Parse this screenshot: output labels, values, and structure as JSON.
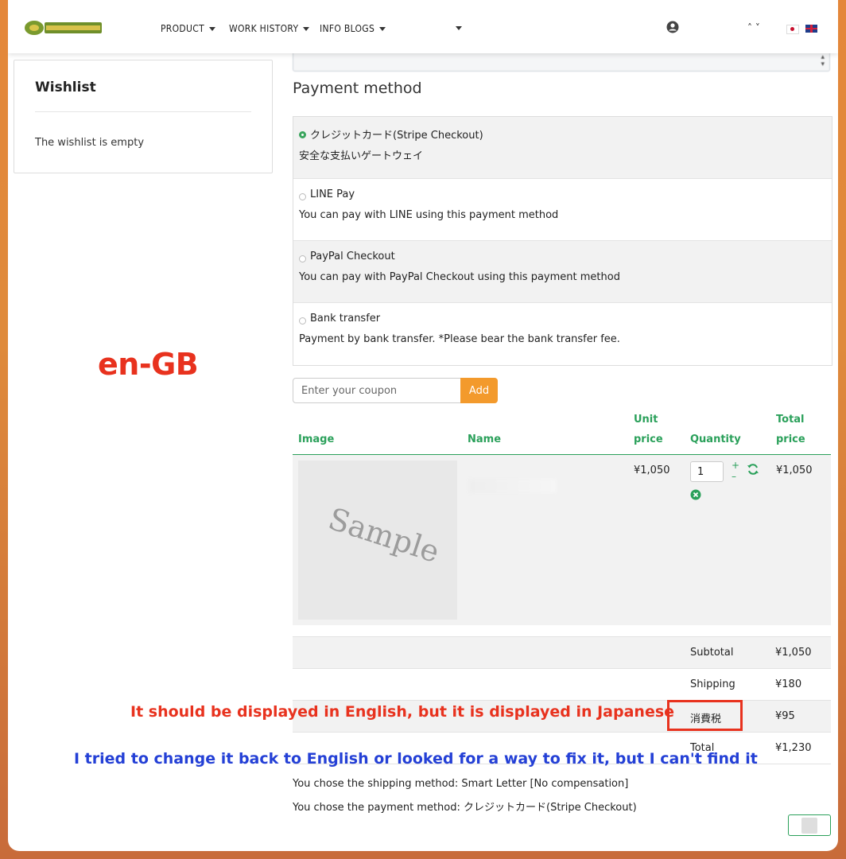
{
  "header": {
    "nav": [
      {
        "label": "PRODUCT"
      },
      {
        "label": "WORK HISTORY"
      },
      {
        "label": "INFO BLOGS"
      }
    ]
  },
  "wishlist": {
    "title": "Wishlist",
    "empty_text": "The wishlist is empty"
  },
  "payment": {
    "title": "Payment method",
    "methods": [
      {
        "name": "クレジットカード(Stripe Checkout)",
        "desc": "安全な支払いゲートウェイ",
        "selected": true
      },
      {
        "name": "LINE Pay",
        "desc": "You can pay with LINE using this payment method",
        "selected": false
      },
      {
        "name": "PayPal Checkout",
        "desc": "You can pay with PayPal Checkout using this payment method",
        "selected": false
      },
      {
        "name": "Bank transfer",
        "desc": "Payment by bank transfer. *Please bear the bank transfer fee.",
        "selected": false
      }
    ]
  },
  "coupon": {
    "placeholder": "Enter your coupon",
    "button": "Add"
  },
  "cart": {
    "headers": {
      "image": "Image",
      "name": "Name",
      "unit_price_1": "Unit",
      "unit_price_2": "price",
      "quantity": "Quantity",
      "total_price_1": "Total",
      "total_price_2": "price"
    },
    "item": {
      "image_text": "Sample",
      "unit_price": "¥1,050",
      "quantity": "1",
      "total_price": "¥1,050"
    }
  },
  "totals": [
    {
      "label": "Subtotal",
      "value": "¥1,050"
    },
    {
      "label": "Shipping",
      "value": "¥180"
    },
    {
      "label": "消費税",
      "value": "¥95"
    },
    {
      "label": "Total",
      "value": "¥1,230"
    }
  ],
  "summary": {
    "shipping": "You chose the shipping method: Smart Letter [No compensation]",
    "payment": "You chose the payment method: クレジットカード(Stripe Checkout)"
  },
  "annotations": {
    "locale": "en-GB",
    "issue": "It should be displayed in English, but it is displayed in Japanese",
    "note": "I tried to change it back to English or looked for a way to fix it, but I can't find it"
  },
  "colors": {
    "accent_green": "#2aa05a",
    "button_orange": "#f39a2c",
    "annotation_red": "#e8321e",
    "annotation_blue": "#2440d6"
  }
}
